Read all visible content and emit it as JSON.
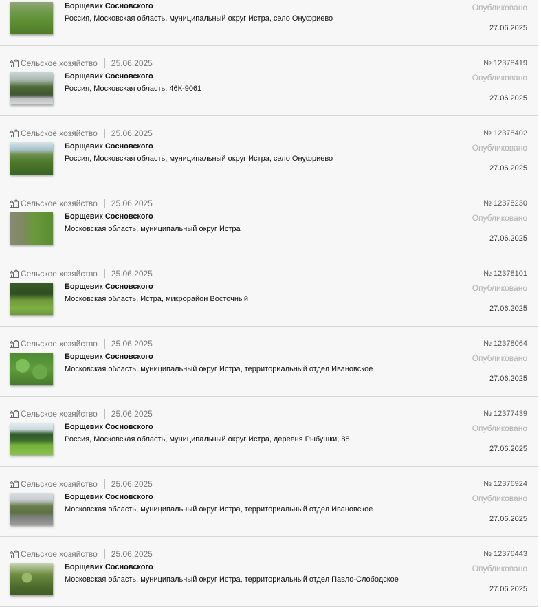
{
  "items": [
    {
      "number": "",
      "category": "",
      "created": "",
      "title": "Борщевик Сосновского",
      "address": "Россия, Московская область, муниципальный округ Истра, село Онуфриево",
      "status": "Опубликовано",
      "published": "27.06.2025",
      "photo": "meadow"
    },
    {
      "number": "№ 12378419",
      "category": "Сельское хозяйство",
      "created": "25.06.2025",
      "title": "Борщевик Сосновского",
      "address": "Россия, Московская область, 46К-9061",
      "status": "Опубликовано",
      "published": "27.06.2025",
      "photo": "road"
    },
    {
      "number": "№ 12378402",
      "category": "Сельское хозяйство",
      "created": "25.06.2025",
      "title": "Борщевик Сосновского",
      "address": "Россия, Московская область, муниципальный округ Истра, село Онуфриево",
      "status": "Опубликовано",
      "published": "27.06.2025",
      "photo": "bush"
    },
    {
      "number": "№ 12378230",
      "category": "Сельское хозяйство",
      "created": "25.06.2025",
      "title": "Борщевик Сосновского",
      "address": "Московская область, муниципальный округ Истра",
      "status": "Опубликовано",
      "published": "27.06.2025",
      "photo": "path"
    },
    {
      "number": "№ 12378101",
      "category": "Сельское хозяйство",
      "created": "25.06.2025",
      "title": "Борщевик Сосновского",
      "address": "Московская область, Истра, микрорайон Восточный",
      "status": "Опубликовано",
      "published": "27.06.2025",
      "photo": "field"
    },
    {
      "number": "№ 12378064",
      "category": "Сельское хозяйство",
      "created": "25.06.2025",
      "title": "Борщевик Сосновского",
      "address": "Московская область, муниципальный округ Истра, территориальный отдел Ивановское",
      "status": "Опубликовано",
      "published": "27.06.2025",
      "photo": "leaves"
    },
    {
      "number": "№ 12377439",
      "category": "Сельское хозяйство",
      "created": "25.06.2025",
      "title": "Борщевик Сосновского",
      "address": "Россия, Московская область, муниципальный округ Истра, деревня Рыбушки, 88",
      "status": "Опубликовано",
      "published": "27.06.2025",
      "photo": "forest"
    },
    {
      "number": "№ 12376924",
      "category": "Сельское хозяйство",
      "created": "25.06.2025",
      "title": "Борщевик Сосновского",
      "address": "Московская область, муниципальный округ Истра, территориальный отдел Ивановское",
      "status": "Опубликовано",
      "published": "27.06.2025",
      "photo": "slope"
    },
    {
      "number": "№ 12376443",
      "category": "Сельское хозяйство",
      "created": "25.06.2025",
      "title": "Борщевик Сосновского",
      "address": "Московская область, муниципальный округ Истра, территориальный отдел Павло-Слободское",
      "status": "Опубликовано",
      "published": "27.06.2025",
      "photo": "plant"
    }
  ]
}
